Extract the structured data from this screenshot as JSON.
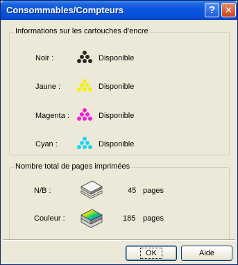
{
  "window": {
    "title": "Consommables/Compteurs",
    "help_glyph": "?",
    "close_glyph": "✕"
  },
  "cartridges": {
    "group_label": "Informations sur les cartouches d'encre",
    "items": [
      {
        "label": "Noir :",
        "status": "Disponible",
        "color": "#2a2a2a"
      },
      {
        "label": "Jaune :",
        "status": "Disponible",
        "color": "#f2f20a"
      },
      {
        "label": "Magenta :",
        "status": "Disponible",
        "color": "#f01fd6"
      },
      {
        "label": "Cyan :",
        "status": "Disponible",
        "color": "#19d7ee"
      }
    ]
  },
  "pages": {
    "group_label": "Nombre total de pages imprimées",
    "items": [
      {
        "label": "N/B :",
        "count": "45",
        "unit": "pages",
        "icon": "paper-stack-icon"
      },
      {
        "label": "Couleur :",
        "count": "185",
        "unit": "pages",
        "icon": "color-paper-stack-icon"
      }
    ]
  },
  "buttons": {
    "ok": "OK",
    "help": "Aide"
  }
}
